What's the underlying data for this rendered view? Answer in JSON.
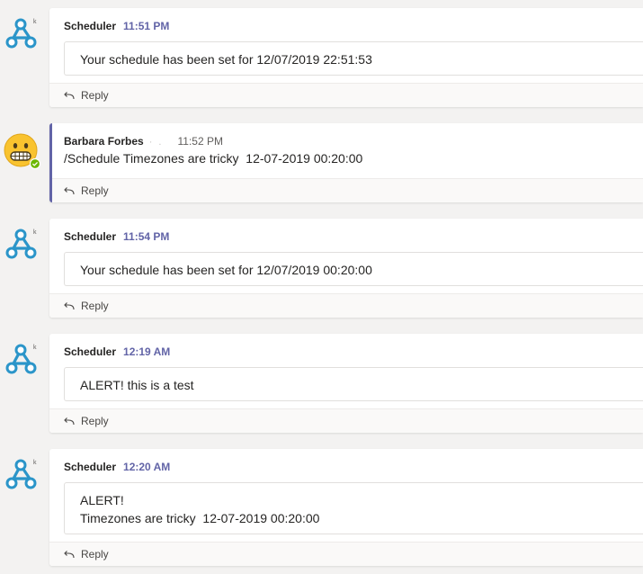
{
  "colors": {
    "accent": "#6264a7",
    "bot_icon": "#2b95c9",
    "background": "#f3f2f1",
    "presence_available": "#6bb700"
  },
  "reply_icon": "reply-arrow-icon",
  "messages": [
    {
      "type": "bot",
      "author": "Scheduler",
      "time": "11:51 PM",
      "lines": [
        "Your schedule has been set for 12/07/2019 22:51:53"
      ],
      "reply_label": "Reply",
      "avatar_icon": "webhook-icon"
    },
    {
      "type": "user",
      "author": "Barbara Forbes",
      "presence_dots": "· .",
      "time": "11:52 PM",
      "text": "/Schedule Timezones are tricky  12-07-2019 00:20:00",
      "reply_label": "Reply",
      "avatar_icon": "grimacing-face-emoji-icon",
      "presence": "available"
    },
    {
      "type": "bot",
      "author": "Scheduler",
      "time": "11:54 PM",
      "lines": [
        "Your schedule has been set for 12/07/2019 00:20:00"
      ],
      "reply_label": "Reply",
      "avatar_icon": "webhook-icon"
    },
    {
      "type": "bot",
      "author": "Scheduler",
      "time": "12:19 AM",
      "lines": [
        "ALERT! this is a test"
      ],
      "reply_label": "Reply",
      "avatar_icon": "webhook-icon"
    },
    {
      "type": "bot",
      "author": "Scheduler",
      "time": "12:20 AM",
      "lines": [
        "ALERT!",
        "Timezones are tricky  12-07-2019 00:20:00"
      ],
      "reply_label": "Reply",
      "avatar_icon": "webhook-icon"
    }
  ]
}
